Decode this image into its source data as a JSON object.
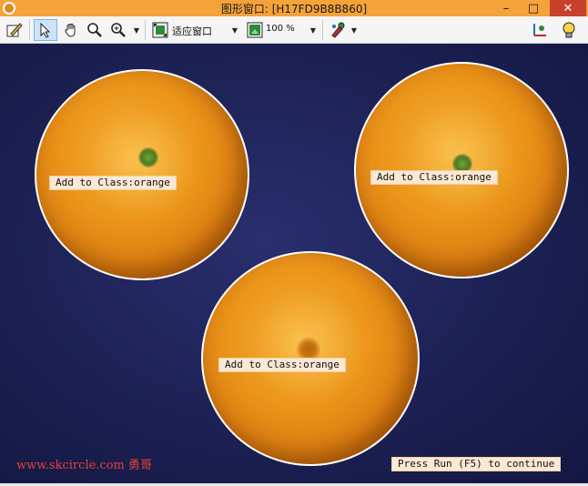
{
  "window": {
    "title": "图形窗口: [H17FD9B8B860]",
    "minimize": "–",
    "maximize": "□",
    "close": "✕"
  },
  "toolbar": {
    "fit_label": "适应窗口",
    "zoom_label": "100 %"
  },
  "canvas": {
    "labels": [
      "Add to Class:orange",
      "Add to Class:orange",
      "Add to Class:orange"
    ],
    "watermark": "www.skcircle.com 勇哥",
    "status": "Press Run (F5) to continue"
  },
  "colors": {
    "title_bar": "#f4a23a",
    "canvas_bg": "#1e2358",
    "orange": "#eb951a",
    "contour": "#ffffff",
    "label_bg": "#fbe8d2",
    "watermark": "#e2433a"
  }
}
